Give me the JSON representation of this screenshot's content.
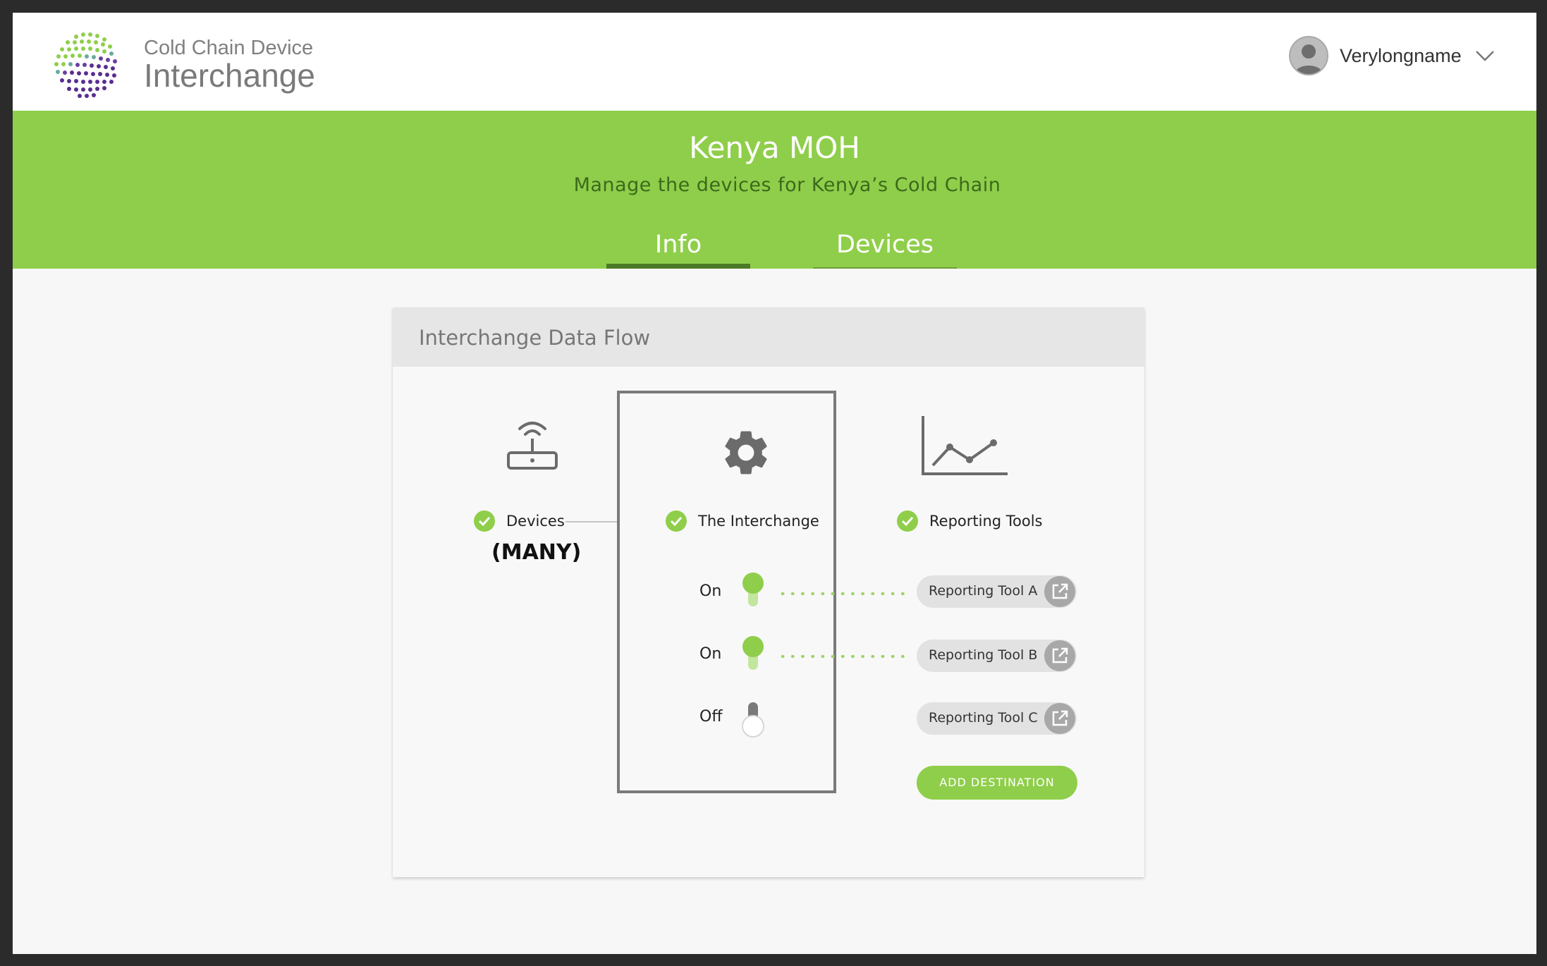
{
  "brand": {
    "line1": "Cold Chain Device",
    "line2": "Interchange",
    "icon": "globe-dots-logo"
  },
  "user": {
    "name": "Verylongname",
    "avatar_icon": "user-avatar-icon",
    "menu_icon": "chevron-down-icon"
  },
  "header": {
    "title": "Kenya MOH",
    "subtitle": "Manage the devices for Kenya’s Cold Chain",
    "tabs": [
      {
        "label": "Info",
        "active": true
      },
      {
        "label": "Devices",
        "active": false
      }
    ]
  },
  "card": {
    "title": "Interchange Data Flow",
    "devices": {
      "icon": "router-icon",
      "label": "Devices",
      "count": "(MANY)",
      "status": "ok"
    },
    "interchange": {
      "icon": "gear-icon",
      "label": "The Interchange",
      "status": "ok",
      "toggles": [
        {
          "label": "On",
          "state": true
        },
        {
          "label": "On",
          "state": true
        },
        {
          "label": "Off",
          "state": false
        }
      ]
    },
    "reporting": {
      "icon": "line-chart-icon",
      "label": "Reporting Tools",
      "status": "ok",
      "tools": [
        {
          "label": "Reporting Tool A",
          "icon": "external-link-icon"
        },
        {
          "label": "Reporting Tool B",
          "icon": "external-link-icon"
        },
        {
          "label": "Reporting Tool C",
          "icon": "external-link-icon"
        }
      ],
      "add_button": "ADD DESTINATION"
    }
  },
  "colors": {
    "accent_green": "#8fce4a",
    "dark_green": "#4e7a26",
    "subtitle_green": "#3c6a1c",
    "icon_gray": "#6b6b6b",
    "dark_frame": "#2b2b2b"
  }
}
